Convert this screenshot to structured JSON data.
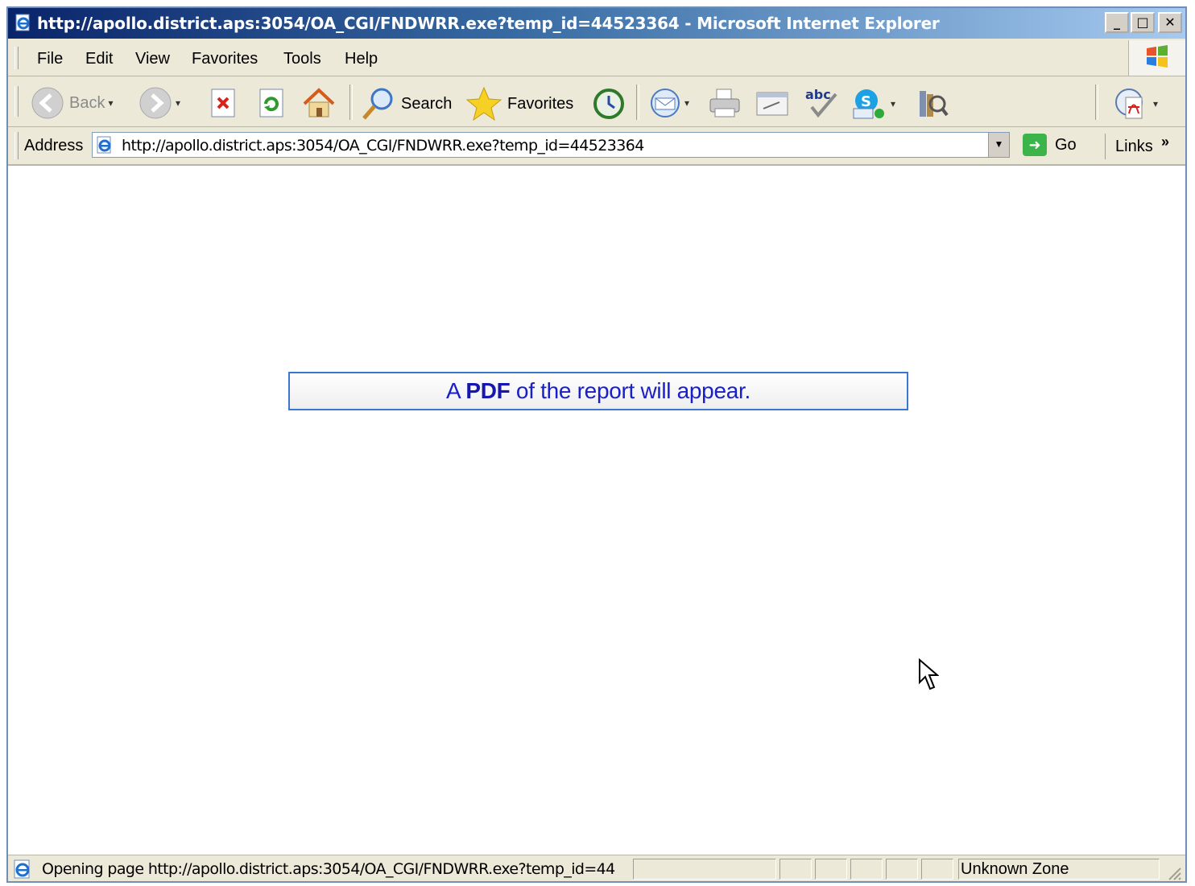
{
  "window": {
    "title": "http://apollo.district.aps:3054/OA_CGI/FNDWRR.exe?temp_id=44523364 - Microsoft Internet Explorer",
    "minimize": "_",
    "maximize": "□",
    "close": "✕"
  },
  "menubar": {
    "items": [
      "File",
      "Edit",
      "View",
      "Favorites",
      "Tools",
      "Help"
    ]
  },
  "toolbar": {
    "back_label": "Back",
    "search_label": "Search",
    "favorites_label": "Favorites"
  },
  "addressbar": {
    "label": "Address",
    "url": "http://apollo.district.aps:3054/OA_CGI/FNDWRR.exe?temp_id=44523364",
    "go_label": "Go",
    "links_label": "Links",
    "more": "»"
  },
  "content": {
    "message_before": "A ",
    "message_bold": "PDF",
    "message_after": " of the report will appear."
  },
  "statusbar": {
    "text": "Opening page http://apollo.district.aps:3054/OA_CGI/FNDWRR.exe?temp_id=44",
    "zone": "Unknown Zone"
  },
  "colors": {
    "title_gradient_start": "#0a246a",
    "chrome": "#ece9d8",
    "message_text": "#1a20c8",
    "message_border": "#3a78d0"
  }
}
